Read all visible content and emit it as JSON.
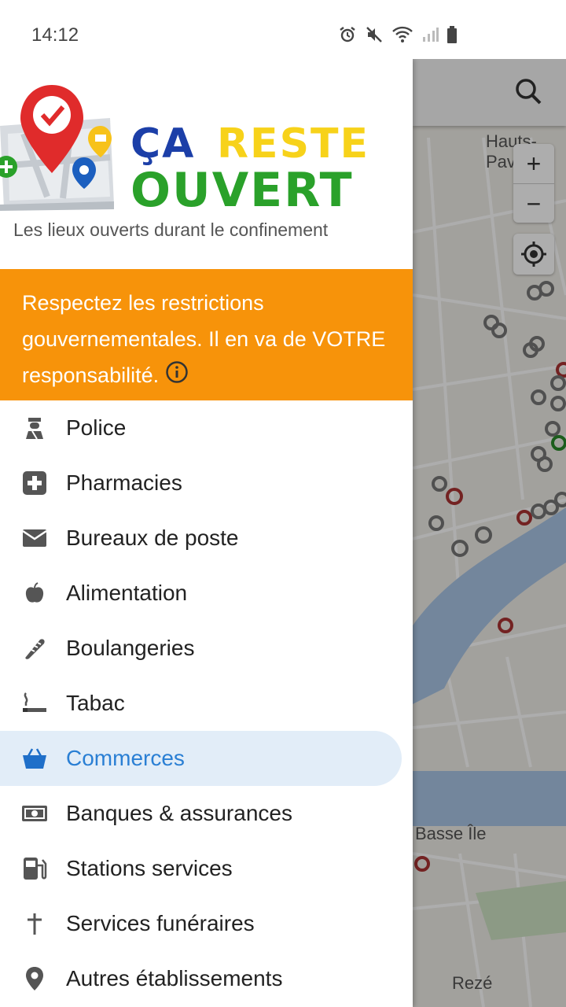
{
  "status_bar": {
    "time": "14:12",
    "icons": [
      "alarm-icon",
      "mute-icon",
      "wifi-icon",
      "signal-icon",
      "battery-icon"
    ]
  },
  "logo": {
    "word_ca": "ÇA",
    "word_reste": "RESTE",
    "word_ouvert": "OUVERT",
    "tagline": "Les lieux ouverts durant le confinement"
  },
  "banner": {
    "text": "Respectez les restrictions gouvernementales. Il en va de VOTRE responsabilité.",
    "color": "#f7930a"
  },
  "menu": {
    "items": [
      {
        "label": "Police",
        "icon": "police-icon"
      },
      {
        "label": "Pharmacies",
        "icon": "pharmacy-cross-icon"
      },
      {
        "label": "Bureaux de poste",
        "icon": "envelope-icon"
      },
      {
        "label": "Alimentation",
        "icon": "apple-icon"
      },
      {
        "label": "Boulangeries",
        "icon": "baguette-icon"
      },
      {
        "label": "Tabac",
        "icon": "cigarette-icon"
      },
      {
        "label": "Commerces",
        "icon": "basket-icon",
        "active": true
      },
      {
        "label": "Banques & assurances",
        "icon": "banknote-icon"
      },
      {
        "label": "Stations services",
        "icon": "fuel-pump-icon"
      },
      {
        "label": "Services funéraires",
        "icon": "cross-icon"
      },
      {
        "label": "Autres établissements",
        "icon": "map-pin-icon"
      }
    ],
    "active_color": "#2a7fd4"
  },
  "map": {
    "zoom_in": "+",
    "zoom_out": "−",
    "labels": {
      "hauts_pave": "Hauts-Pav",
      "basse_ile": "Basse Île",
      "reze": "Rezé"
    }
  }
}
